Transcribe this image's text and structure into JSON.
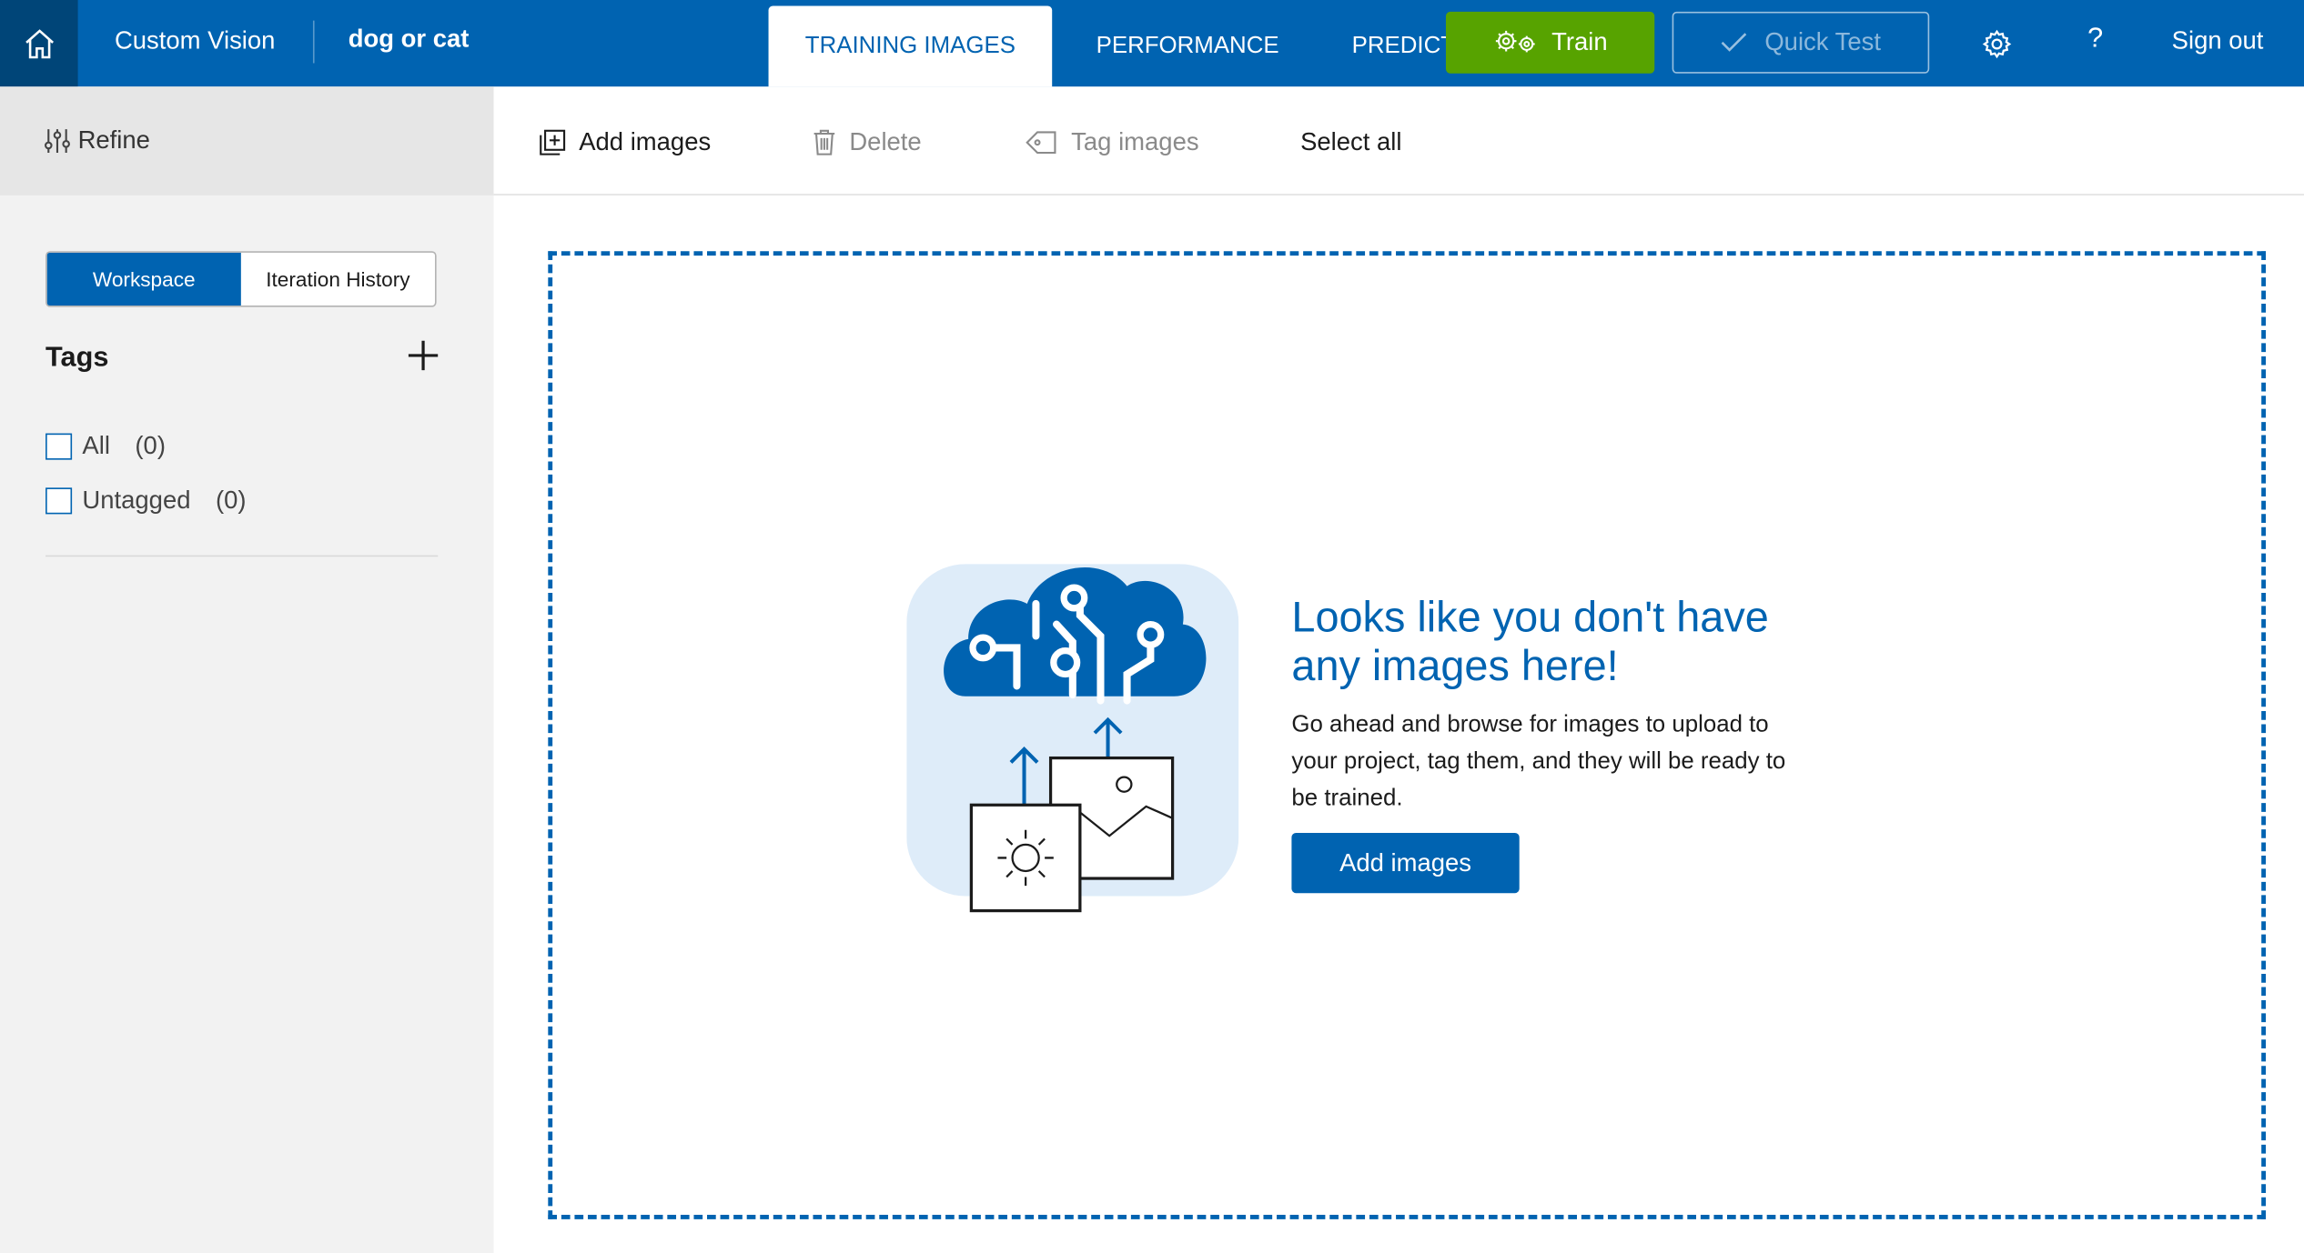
{
  "header": {
    "home_icon": "home-icon",
    "app_title": "Custom Vision",
    "project_name": "dog or cat",
    "tabs": [
      {
        "label": "TRAINING IMAGES",
        "active": true
      },
      {
        "label": "PERFORMANCE",
        "active": false
      },
      {
        "label": "PREDICT",
        "active": false
      }
    ],
    "train_label": "Train",
    "quick_test_label": "Quick Test",
    "help_label": "?",
    "sign_out_label": "Sign out",
    "icons": [
      "gears-icon",
      "checkmark-icon",
      "settings-gear-icon"
    ],
    "accent_color": "#0063b1",
    "train_color": "#57a300"
  },
  "sidebar": {
    "refine_label": "Refine",
    "segments": [
      {
        "label": "Workspace",
        "active": true
      },
      {
        "label": "Iteration History",
        "active": false
      }
    ],
    "tags_title": "Tags",
    "tags": [
      {
        "label": "All",
        "count": "(0)"
      },
      {
        "label": "Untagged",
        "count": "(0)"
      }
    ]
  },
  "toolbar": {
    "add_images": "Add images",
    "delete": "Delete",
    "tag_images": "Tag images",
    "select_all": "Select all"
  },
  "empty_state": {
    "heading": "Looks like you don't have any images here!",
    "body": "Go ahead and browse for images to upload to your project, tag them, and they will be ready to be trained.",
    "button": "Add images"
  }
}
